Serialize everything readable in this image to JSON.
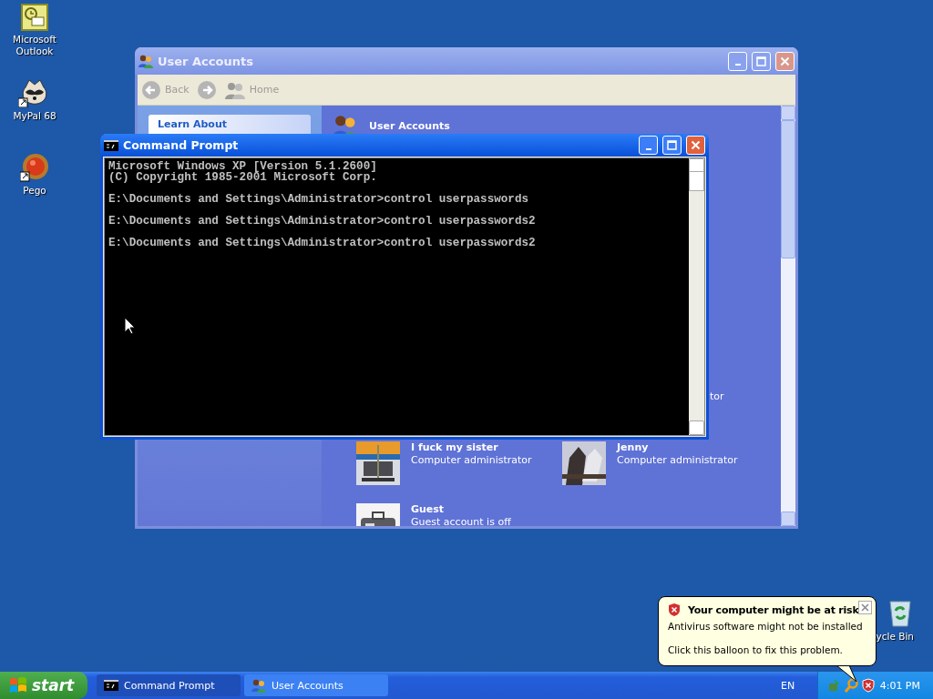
{
  "desktop_icons": [
    {
      "kind": "outlook",
      "label": "Microsoft\nOutlook"
    },
    {
      "kind": "raccoon",
      "label": "MyPal 68"
    },
    {
      "kind": "orb",
      "label": "Pego"
    }
  ],
  "user_accounts_window": {
    "title": "User Accounts",
    "toolbar": [
      {
        "kind": "back",
        "label": "Back"
      },
      {
        "kind": "forward"
      },
      {
        "kind": "home",
        "label": "Home"
      }
    ],
    "sidebar": {
      "heading": "Learn About"
    },
    "header": "User Accounts",
    "hidden_fragment": "tor",
    "accounts": [
      {
        "name": "I fuck my sister",
        "type": "Computer administrator"
      },
      {
        "name": "Jenny",
        "type": "Computer administrator"
      },
      {
        "name": "Guest",
        "type": "Guest account is off"
      }
    ]
  },
  "command_prompt": {
    "title": "Command Prompt",
    "blocks": [
      [
        "Microsoft Windows XP [Version 5.1.2600]",
        "(C) Copyright 1985-2001 Microsoft Corp."
      ],
      [
        "E:\\Documents and Settings\\Administrator>control userpasswords"
      ],
      [
        "E:\\Documents and Settings\\Administrator>control userpasswords2"
      ],
      [
        "E:\\Documents and Settings\\Administrator>control userpasswords2"
      ]
    ]
  },
  "recycle_bin": {
    "label": "ycle Bin"
  },
  "balloon": {
    "title": "Your computer might be at risk",
    "lines": [
      "Antivirus software might not be installed",
      "Click this balloon to fix this problem."
    ]
  },
  "taskbar": {
    "start": "start",
    "tasks": [
      {
        "kind": "cmd",
        "label": "Command Prompt",
        "selected": true
      },
      {
        "kind": "users",
        "label": "User Accounts",
        "selected": false
      }
    ],
    "language": "EN",
    "clock": "4:01 PM"
  }
}
